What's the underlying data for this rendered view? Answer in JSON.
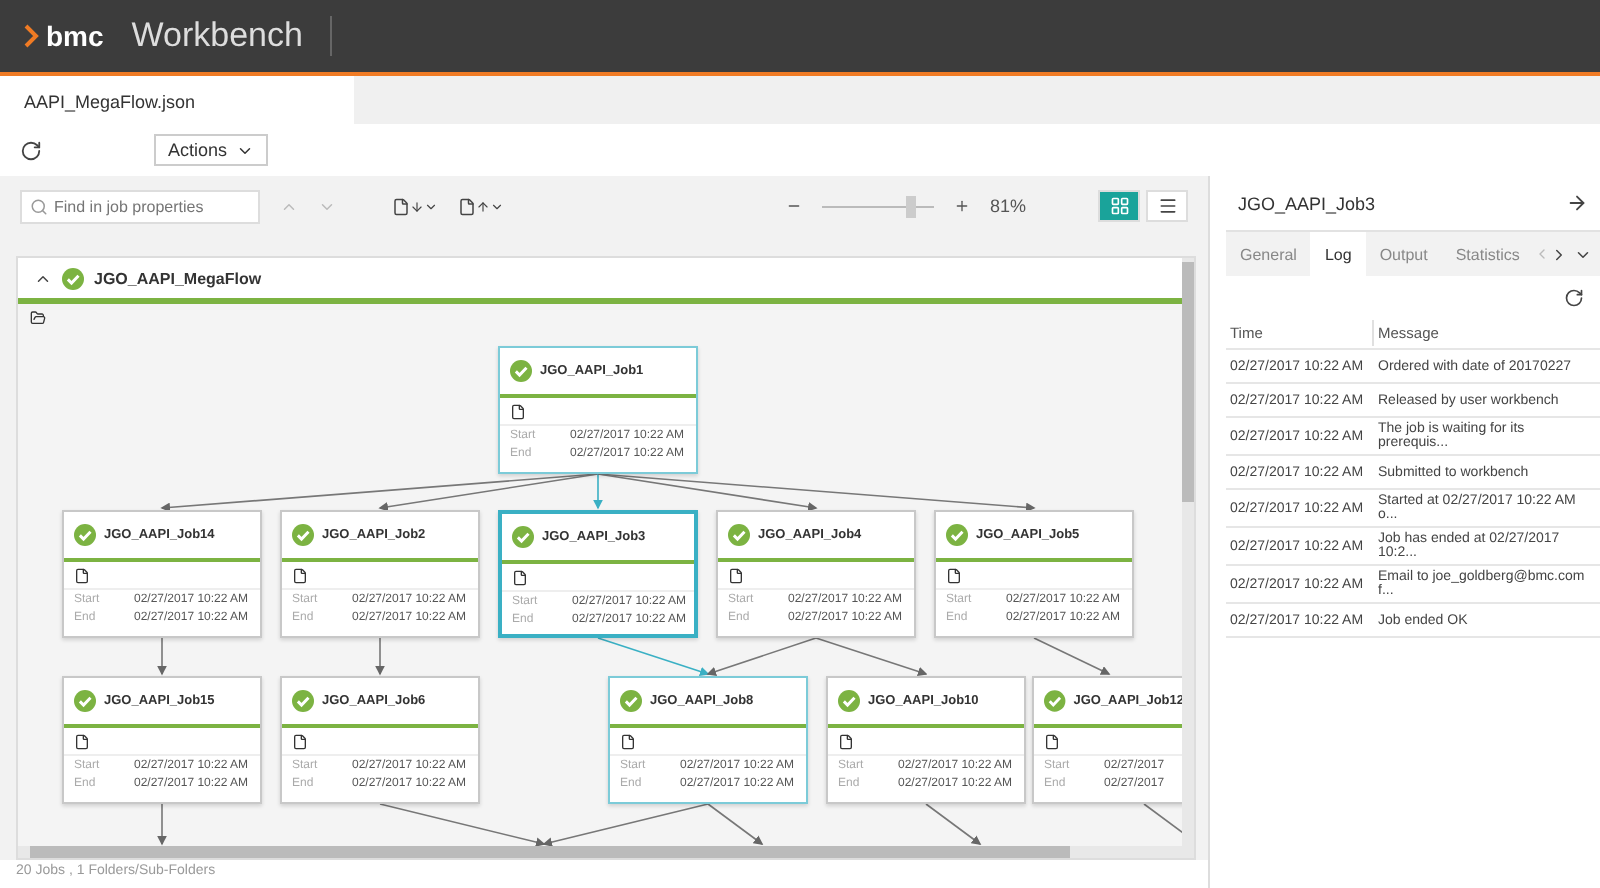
{
  "app": {
    "brand": "bmc",
    "title": "Workbench"
  },
  "file_tabs": [
    {
      "label": "AAPI_MegaFlow.json",
      "selected": true
    }
  ],
  "toolbar": {
    "actions_label": "Actions"
  },
  "search": {
    "placeholder": "Find in job properties"
  },
  "zoom": {
    "level": 0.78,
    "reading": "81%"
  },
  "view_modes": [
    {
      "kind": "grid",
      "selected": true
    },
    {
      "kind": "list",
      "selected": false
    }
  ],
  "flow": {
    "name": "JGO_AAPI_MegaFlow",
    "expanded": true,
    "jobs": [
      {
        "name": "JGO_AAPI_Job1",
        "start_label": "Start",
        "start": "02/27/2017 10:22 AM",
        "end_label": "End",
        "end": "02/27/2017 10:22 AM",
        "selected": false,
        "linked": true
      },
      {
        "name": "JGO_AAPI_Job14",
        "start_label": "Start",
        "start": "02/27/2017 10:22 AM",
        "end_label": "End",
        "end": "02/27/2017 10:22 AM",
        "selected": false,
        "linked": false
      },
      {
        "name": "JGO_AAPI_Job2",
        "start_label": "Start",
        "start": "02/27/2017 10:22 AM",
        "end_label": "End",
        "end": "02/27/2017 10:22 AM",
        "selected": false,
        "linked": false
      },
      {
        "name": "JGO_AAPI_Job3",
        "start_label": "Start",
        "start": "02/27/2017 10:22 AM",
        "end_label": "End",
        "end": "02/27/2017 10:22 AM",
        "selected": true,
        "linked": false
      },
      {
        "name": "JGO_AAPI_Job4",
        "start_label": "Start",
        "start": "02/27/2017 10:22 AM",
        "end_label": "End",
        "end": "02/27/2017 10:22 AM",
        "selected": false,
        "linked": false
      },
      {
        "name": "JGO_AAPI_Job5",
        "start_label": "Start",
        "start": "02/27/2017 10:22 AM",
        "end_label": "End",
        "end": "02/27/2017 10:22 AM",
        "selected": false,
        "linked": false
      },
      {
        "name": "JGO_AAPI_Job15",
        "start_label": "Start",
        "start": "02/27/2017 10:22 AM",
        "end_label": "End",
        "end": "02/27/2017 10:22 AM",
        "selected": false,
        "linked": false
      },
      {
        "name": "JGO_AAPI_Job6",
        "start_label": "Start",
        "start": "02/27/2017 10:22 AM",
        "end_label": "End",
        "end": "02/27/2017 10:22 AM",
        "selected": false,
        "linked": false
      },
      {
        "name": "JGO_AAPI_Job8",
        "start_label": "Start",
        "start": "02/27/2017 10:22 AM",
        "end_label": "End",
        "end": "02/27/2017 10:22 AM",
        "selected": false,
        "linked": true
      },
      {
        "name": "JGO_AAPI_Job10",
        "start_label": "Start",
        "start": "02/27/2017 10:22 AM",
        "end_label": "End",
        "end": "02/27/2017 10:22 AM",
        "selected": false,
        "linked": false
      },
      {
        "name": "JGO_AAPI_Job12",
        "start_label": "Start",
        "start": "02/27/2017",
        "end_label": "End",
        "end": "02/27/2017",
        "selected": false,
        "linked": false
      }
    ]
  },
  "status_bar": "20 Jobs , 1 Folders/Sub-Folders",
  "details": {
    "title": "JGO_AAPI_Job3",
    "tabs": [
      {
        "label": "General",
        "selected": false
      },
      {
        "label": "Log",
        "selected": true
      },
      {
        "label": "Output",
        "selected": false
      },
      {
        "label": "Statistics",
        "selected": false
      }
    ],
    "columns": [
      "Time",
      "Message"
    ],
    "rows": [
      {
        "time": "02/27/2017 10:22 AM",
        "message": "Ordered with date of 20170227"
      },
      {
        "time": "02/27/2017 10:22 AM",
        "message": "Released by user workbench"
      },
      {
        "time": "02/27/2017 10:22 AM",
        "message": "The job is waiting for its prerequis..."
      },
      {
        "time": "02/27/2017 10:22 AM",
        "message": "Submitted to workbench"
      },
      {
        "time": "02/27/2017 10:22 AM",
        "message": "Started at 02/27/2017 10:22 AM o..."
      },
      {
        "time": "02/27/2017 10:22 AM",
        "message": "Job has ended at 02/27/2017 10:2..."
      },
      {
        "time": "02/27/2017 10:22 AM",
        "message": "Email to joe_goldberg@bmc.com f..."
      },
      {
        "time": "02/27/2017 10:22 AM",
        "message": "Job ended OK"
      }
    ]
  }
}
